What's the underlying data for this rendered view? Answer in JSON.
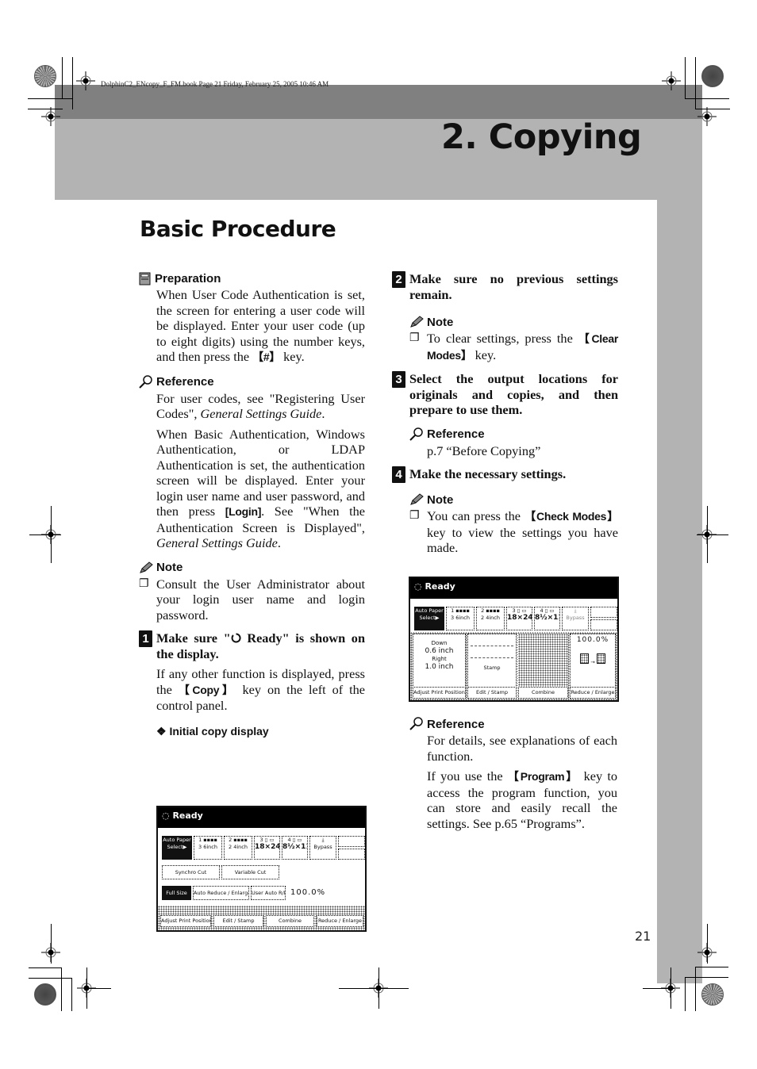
{
  "header_meta": "DolphinC2_ENcopy_F_FM.book  Page 21  Friday, February 25, 2005  10:46 AM",
  "chapter_title": "2. Copying",
  "section_title": "Basic Procedure",
  "page_number": "21",
  "left": {
    "preparation": {
      "label": "Preparation",
      "icon": "preparation-icon",
      "text_a": "When User Code Authentication is set, the screen for entering a user code will be displayed. Enter your user code (up to eight digits) using the number keys, and then press the ",
      "key": "【#】",
      "text_b": " key."
    },
    "reference": {
      "label": "Reference",
      "icon": "magnifier-icon",
      "p1_a": "For user codes, see \"Registering User Codes\", ",
      "p1_italic": "General Settings Guide",
      "p1_b": ".",
      "p2_a": "When Basic Authentication, Windows Authentication, or LDAP Authentication is set, the authentication screen will be displayed. Enter your login user name and user password, and then press ",
      "p2_key": "[Login]",
      "p2_b": ". See \"When the Authentication Screen is Displayed\", ",
      "p2_italic": "General Settings Guide",
      "p2_c": "."
    },
    "note": {
      "label": "Note",
      "icon": "pencil-icon",
      "item": "Consult the User Administrator about your login user name and login password."
    },
    "step1": {
      "number": "1",
      "title_a": "Make sure \"",
      "title_icon": "ready-circle-icon",
      "title_b": " Ready\" is shown on the display.",
      "text_a": "If any other function is displayed, press the ",
      "key": "【Copy】",
      "text_b": " key on the left of the control panel."
    },
    "figure_caption": "Initial copy display",
    "panel": {
      "status": "Ready",
      "trays": [
        {
          "label_line1": "Auto Paper",
          "label_line2": "Select▶",
          "selected": true
        },
        {
          "label_line1": "1 ▪▪▪▪",
          "label_line2": "3 6inch"
        },
        {
          "label_line1": "2 ▪▪▪▪",
          "label_line2": "2 4inch"
        },
        {
          "label_line1": "3 ▯ ▭",
          "label_line2": "18×24"
        },
        {
          "label_line1": "4 ▯ ▭",
          "label_line2": "8½×11"
        },
        {
          "label_line1": "⤓",
          "label_line2": "Bypass"
        }
      ],
      "cut_buttons": [
        "Synchro Cut",
        "Variable Cut"
      ],
      "ratio_buttons": [
        "Full Size",
        "Auto Reduce / Enlarge",
        "User Auto R/E"
      ],
      "ratio_value": "100.0%",
      "function_tabs": [
        "Adjust Print Position",
        "Edit / Stamp",
        "Combine",
        "Reduce / Enlarge"
      ]
    }
  },
  "right": {
    "step2": {
      "number": "2",
      "title": "Make sure no previous settings remain.",
      "note_label": "Note",
      "note_a": "To clear settings, press the ",
      "note_key": "【Clear Modes】",
      "note_b": " key."
    },
    "step3": {
      "number": "3",
      "title": "Select the output locations for originals and copies, and then prepare to use them.",
      "ref_label": "Reference",
      "ref_text": "p.7 “Before Copying”"
    },
    "step4": {
      "number": "4",
      "title": "Make the necessary settings.",
      "note_label": "Note",
      "note_a": "You can press the ",
      "note_key": "【Check Modes】",
      "note_b": " key to view the settings you have made."
    },
    "panel": {
      "status": "Ready",
      "trays": [
        {
          "label_line1": "Auto Paper",
          "label_line2": "Select▶",
          "selected": true
        },
        {
          "label_line1": "1 ▪▪▪▪",
          "label_line2": "3 6inch"
        },
        {
          "label_line1": "2 ▪▪▪▪",
          "label_line2": "2 4inch"
        },
        {
          "label_line1": "3 ▯ ▭",
          "label_line2": "18×24"
        },
        {
          "label_line1": "4 ▯ ▭",
          "label_line2": "8½×11"
        },
        {
          "label_line1": "⤓",
          "label_line2": "Bypass"
        }
      ],
      "adjust": {
        "down_label": "Down",
        "down_value": "0.6 inch",
        "right_label": "Right",
        "right_value": "1.0 inch"
      },
      "stamp_label": "Stamp",
      "ratio_value": "100.0%",
      "function_tabs": [
        "Adjust Print Position",
        "Edit / Stamp",
        "Combine",
        "Reduce / Enlarge"
      ]
    },
    "reference": {
      "label": "Reference",
      "p1": "For details, see explanations of each function.",
      "p2_a": "If you use the ",
      "p2_key": "【Program】",
      "p2_b": " key to access the program function, you can store and easily recall the settings. See p.65 “Programs”."
    }
  }
}
